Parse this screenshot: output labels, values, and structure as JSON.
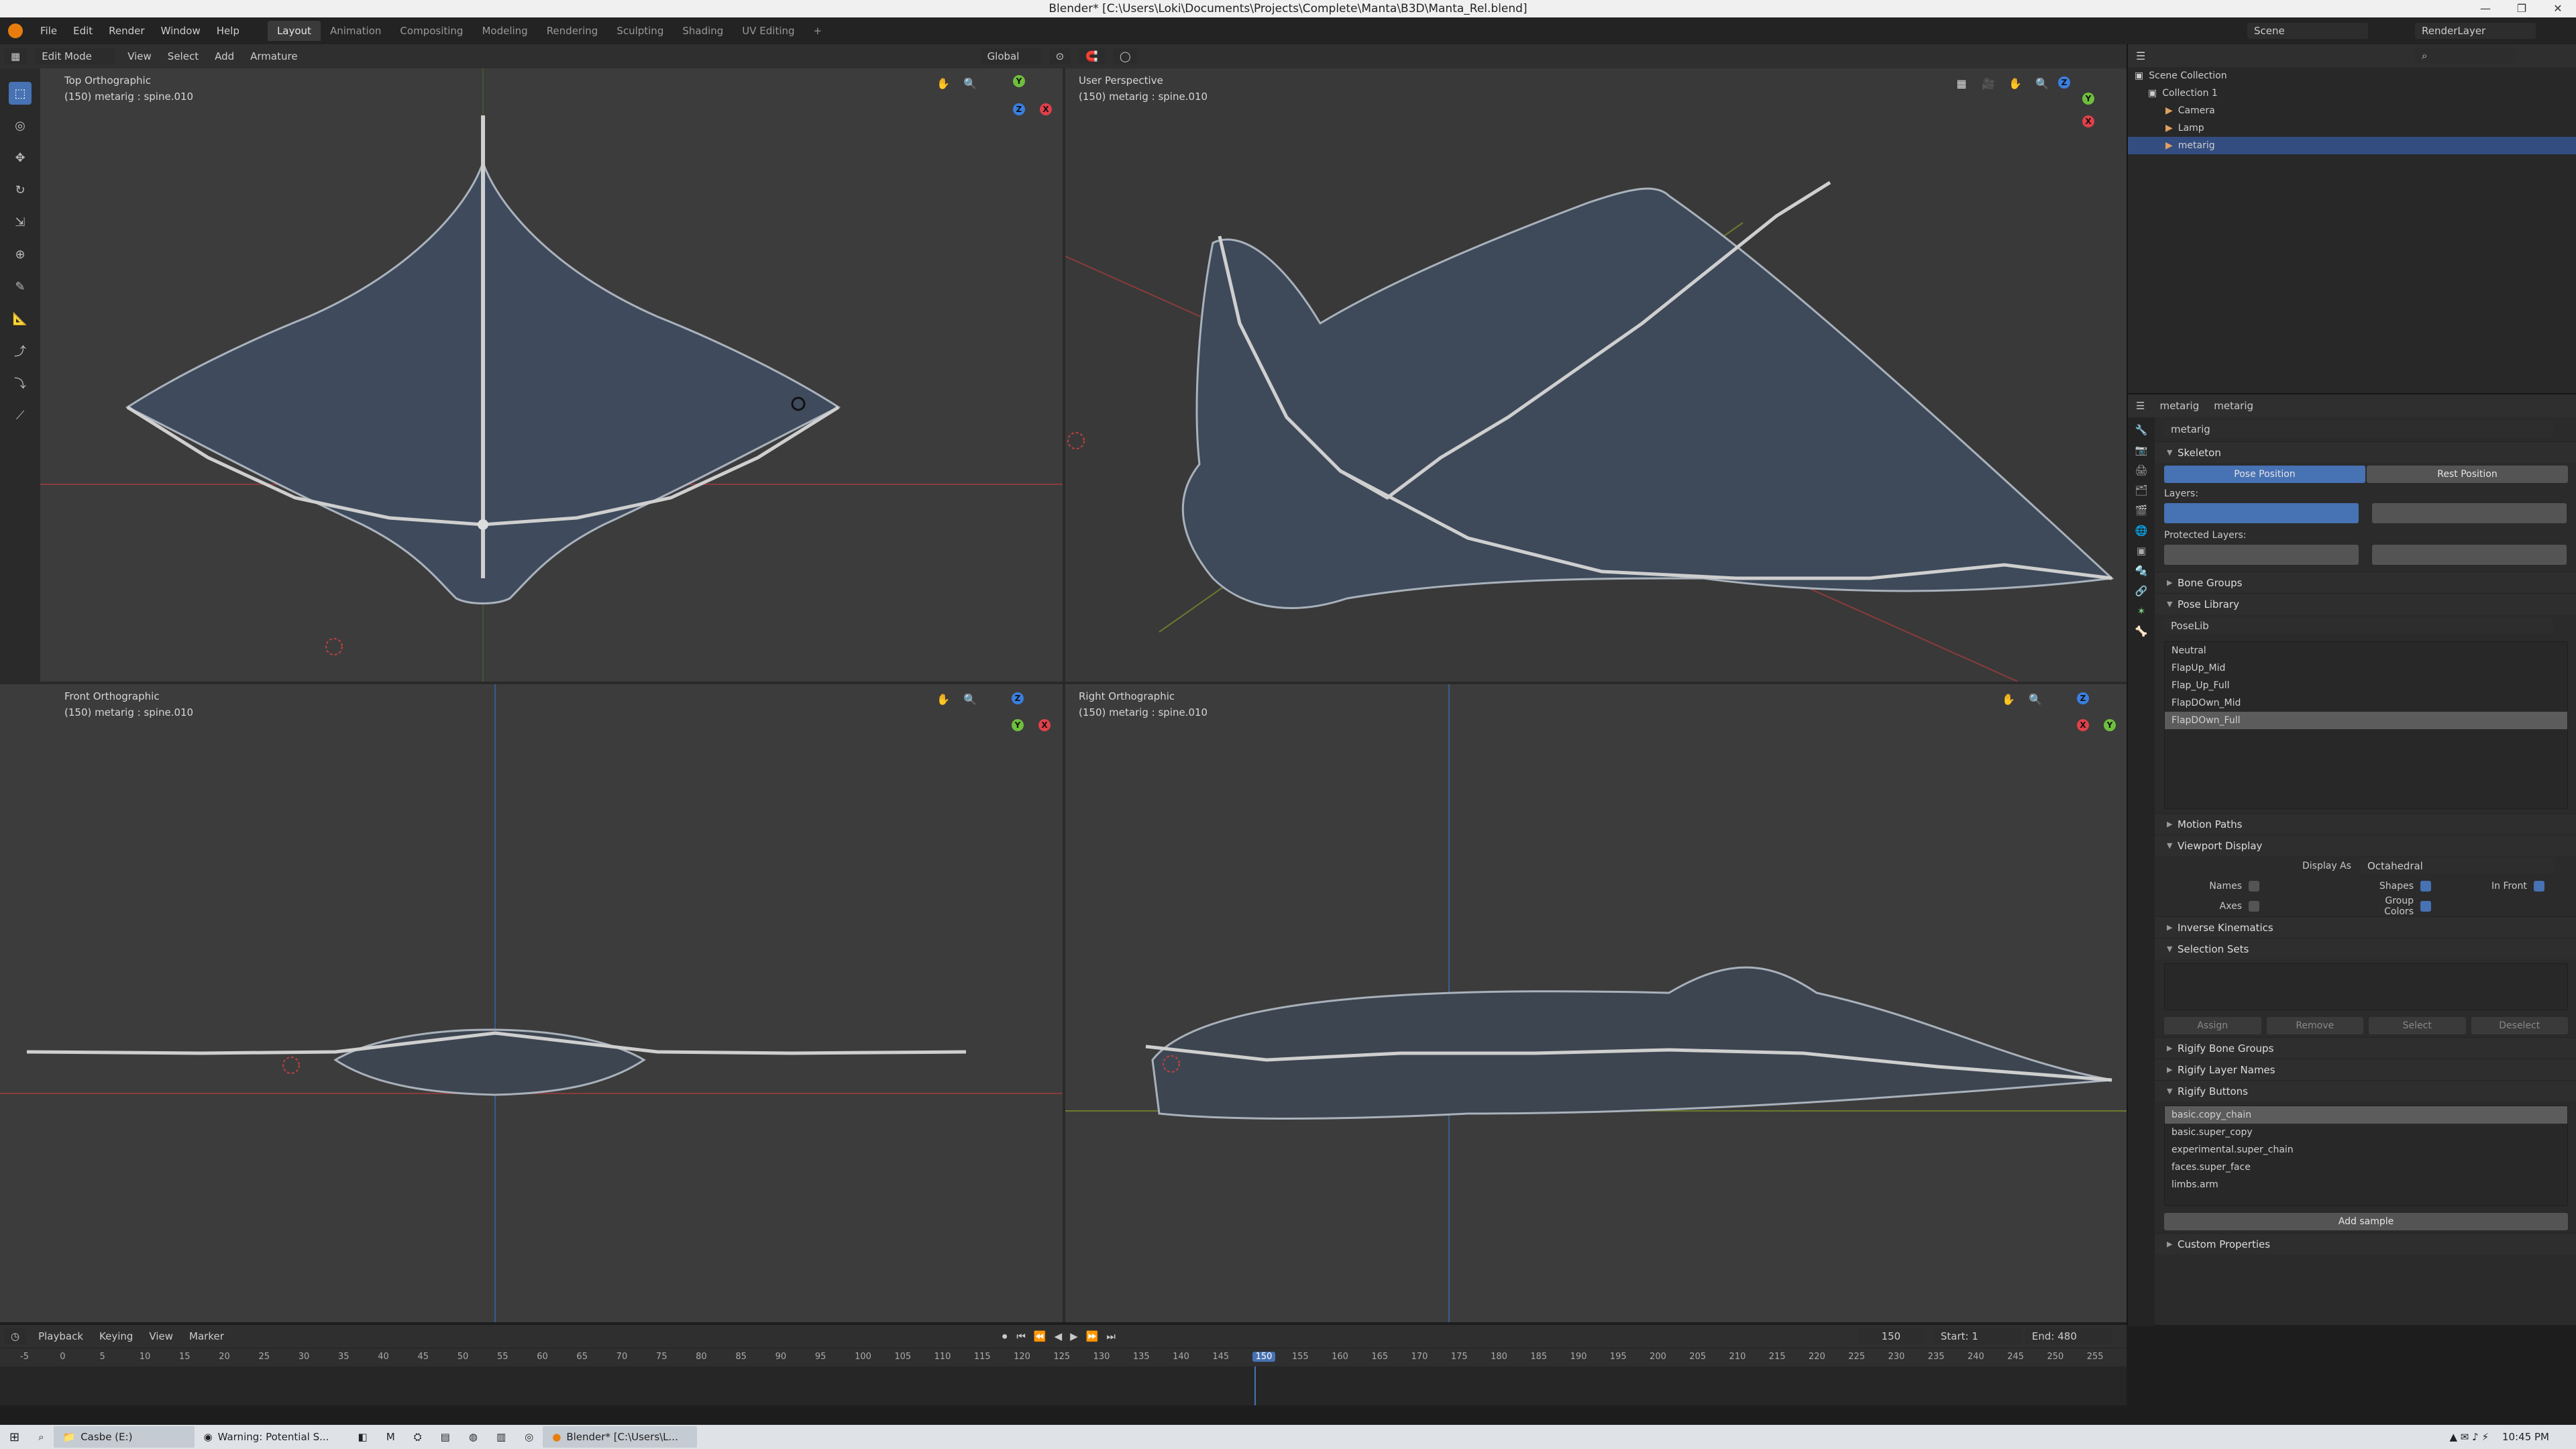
{
  "window": {
    "title": "Blender* [C:\\Users\\Loki\\Documents\\Projects\\Complete\\Manta\\B3D\\Manta_Rel.blend]",
    "controls": [
      "—",
      "❐",
      "✕"
    ]
  },
  "menus": [
    "File",
    "Edit",
    "Render",
    "Window",
    "Help"
  ],
  "workspaces": [
    "Layout",
    "Animation",
    "Compositing",
    "Modeling",
    "Rendering",
    "Sculpting",
    "Shading",
    "UV Editing",
    "+"
  ],
  "scene": {
    "name": "Scene",
    "render_layer": "RenderLayer"
  },
  "viewport_header": {
    "mode": "Edit Mode",
    "menus": [
      "View",
      "Select",
      "Add",
      "Armature"
    ],
    "transform": "Global"
  },
  "viewports": [
    {
      "name": "Top Orthographic",
      "info": "(150) metarig : spine.010"
    },
    {
      "name": "User Perspective",
      "info": "(150) metarig : spine.010"
    },
    {
      "name": "Front Orthographic",
      "info": "(150) metarig : spine.010"
    },
    {
      "name": "Right Orthographic",
      "info": "(150) metarig : spine.010"
    }
  ],
  "gizmo": {
    "x": "X",
    "y": "Y",
    "z": "Z",
    "colors": {
      "x": "#e0404a",
      "y": "#6ec03c",
      "z": "#3a7fe0"
    }
  },
  "outliner": {
    "root": "Scene Collection",
    "items": [
      {
        "label": "Collection 1"
      },
      {
        "label": "Camera"
      },
      {
        "label": "Lamp"
      },
      {
        "label": "metarig"
      }
    ]
  },
  "properties": {
    "object_name": "metarig",
    "data_name": "metarig",
    "field": "metarig",
    "skeleton": {
      "title": "Skeleton",
      "pose_btn": "Pose Position",
      "rest_btn": "Rest Position",
      "layers": "Layers:",
      "protected": "Protected Layers:"
    },
    "bone_groups": "Bone Groups",
    "pose_library": {
      "title": "Pose Library",
      "name": "PoseLib",
      "items": [
        "Neutral",
        "FlapUp_Mid",
        "Flap_Up_Full",
        "FlapDOwn_Mid",
        "FlapDOwn_Full"
      ]
    },
    "motion_paths": "Motion Paths",
    "viewport_display": {
      "title": "Viewport Display",
      "display_as_label": "Display As",
      "display_as": "Octahedral",
      "names": "Names",
      "shapes": "Shapes",
      "in_front": "In Front",
      "axes": "Axes",
      "group_colors": "Group Colors"
    },
    "inverse_kinematics": "Inverse Kinematics",
    "selection_sets": {
      "title": "Selection Sets",
      "buttons": [
        "Assign",
        "Remove",
        "Select",
        "Deselect"
      ]
    },
    "rigify_bone_groups": "Rigify Bone Groups",
    "rigify_layer_names": "Rigify Layer Names",
    "rigify_buttons": {
      "title": "Rigify Buttons",
      "items": [
        "basic.copy_chain",
        "basic.super_copy",
        "experimental.super_chain",
        "faces.super_face",
        "limbs.arm"
      ],
      "add_sample": "Add sample"
    },
    "custom_properties": "Custom Properties"
  },
  "timeline": {
    "menus": [
      "Playback",
      "Keying",
      "View",
      "Marker"
    ],
    "current_frame": "150",
    "start_label": "Start:",
    "start": "1",
    "end_label": "End:",
    "end": "480",
    "ticks": [
      "-5",
      "0",
      "5",
      "10",
      "15",
      "20",
      "25",
      "30",
      "35",
      "40",
      "45",
      "50",
      "55",
      "60",
      "65",
      "70",
      "75",
      "80",
      "85",
      "90",
      "95",
      "100",
      "105",
      "110",
      "115",
      "120",
      "125",
      "130",
      "135",
      "140",
      "145",
      "150",
      "155",
      "160",
      "165",
      "170",
      "175",
      "180",
      "185",
      "190",
      "195",
      "200",
      "205",
      "210",
      "215",
      "220",
      "225",
      "230",
      "235",
      "240",
      "245",
      "250",
      "255"
    ]
  },
  "taskbar": {
    "items": [
      {
        "label": "Casbe (E:)"
      },
      {
        "label": "Warning: Potential S..."
      },
      {
        "label": "Blender* [C:\\Users\\L..."
      }
    ],
    "clock": "10:45 PM"
  }
}
